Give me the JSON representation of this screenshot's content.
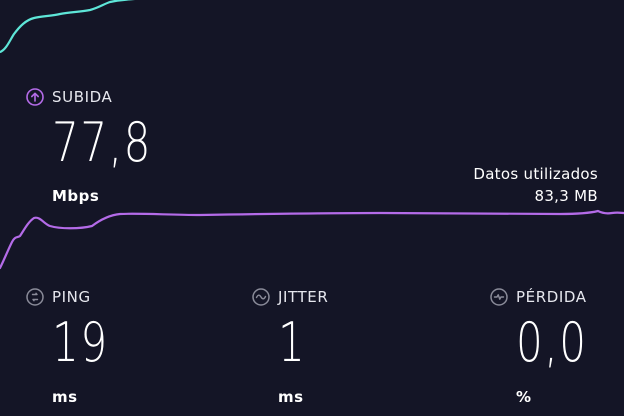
{
  "colors": {
    "background": "#141526",
    "download_accent": "#5ee6d8",
    "upload_accent": "#b46be8",
    "icon_gray": "#8a8b99"
  },
  "upload": {
    "label": "SUBIDA",
    "icon": "upload-arrow-icon",
    "value": "77,8",
    "unit": "Mbps"
  },
  "data_used": {
    "label": "Datos utilizados",
    "value": "83,3 MB"
  },
  "metrics": {
    "ping": {
      "label": "PING",
      "icon": "ping-icon",
      "value": "19",
      "unit": "ms"
    },
    "jitter": {
      "label": "JITTER",
      "icon": "jitter-icon",
      "value": "1",
      "unit": "ms"
    },
    "loss": {
      "label": "PÉRDIDA",
      "icon": "packet-loss-icon",
      "value": "0,0",
      "unit": "%"
    }
  }
}
